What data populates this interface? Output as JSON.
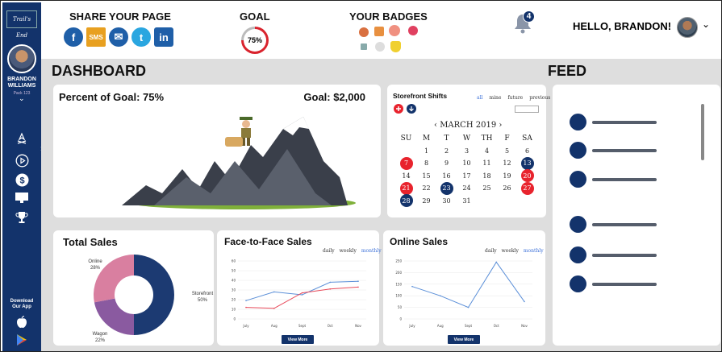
{
  "brand": {
    "logo_text": "Trail's End"
  },
  "sidebar": {
    "user_name_line1": "BRANDON",
    "user_name_line2": "WILLIAMS",
    "pack": "Pack 123",
    "download_line1": "Download",
    "download_line2": "Our App",
    "icons": [
      "campfire-icon",
      "play-icon",
      "dollar-icon",
      "monitor-icon",
      "trophy-icon"
    ]
  },
  "header": {
    "share_title": "SHARE YOUR PAGE",
    "share_buttons": [
      {
        "name": "facebook-icon",
        "glyph": "f",
        "color": "#1f5fa8"
      },
      {
        "name": "sms-icon",
        "glyph": "SMS",
        "color": "#e8a020"
      },
      {
        "name": "email-icon",
        "glyph": "✉",
        "color": "#1f5fa8"
      },
      {
        "name": "twitter-icon",
        "glyph": "t",
        "color": "#2aa6e0"
      },
      {
        "name": "linkedin-icon",
        "glyph": "in",
        "color": "#1f5fa8"
      }
    ],
    "goal_title": "GOAL",
    "goal_pct": "75%",
    "goal_value": 0.75,
    "badges_title": "YOUR BADGES",
    "notification_count": "4",
    "greeting": "HELLO, BRANDON!"
  },
  "dashboard": {
    "title": "DASHBOARD",
    "goal_card": {
      "percent_label": "Percent of Goal: 75%",
      "goal_label": "Goal: $2,000"
    },
    "shifts": {
      "title": "Storefront Shifts",
      "tabs": [
        "all",
        "mine",
        "future",
        "previous"
      ],
      "active_tab": "all",
      "search_placeholder": "",
      "month": "MARCH 2019",
      "prev": "‹",
      "next": "›",
      "days_of_week": [
        "SU",
        "M",
        "T",
        "W",
        "TH",
        "F",
        "SA"
      ],
      "weeks": [
        [
          {
            "d": ""
          },
          {
            "d": "1"
          },
          {
            "d": "2"
          },
          {
            "d": "3"
          },
          {
            "d": "4"
          },
          {
            "d": "5"
          },
          {
            "d": "6"
          }
        ],
        [
          {
            "d": "7",
            "s": "red"
          },
          {
            "d": "8"
          },
          {
            "d": "9"
          },
          {
            "d": "10"
          },
          {
            "d": "11"
          },
          {
            "d": "12"
          },
          {
            "d": "13",
            "s": "blue"
          }
        ],
        [
          {
            "d": "14"
          },
          {
            "d": "15"
          },
          {
            "d": "16"
          },
          {
            "d": "17"
          },
          {
            "d": "18"
          },
          {
            "d": "19"
          },
          {
            "d": "20",
            "s": "red"
          }
        ],
        [
          {
            "d": "21",
            "s": "red"
          },
          {
            "d": "22"
          },
          {
            "d": "23",
            "s": "blue"
          },
          {
            "d": "24"
          },
          {
            "d": "25"
          },
          {
            "d": "26"
          },
          {
            "d": "27",
            "s": "red"
          }
        ],
        [
          {
            "d": "28",
            "s": "blue"
          },
          {
            "d": "29"
          },
          {
            "d": "30"
          },
          {
            "d": "31"
          },
          {
            "d": ""
          },
          {
            "d": ""
          },
          {
            "d": ""
          }
        ]
      ]
    },
    "total_sales": {
      "title": "Total Sales",
      "chart_data": {
        "type": "pie",
        "slices": [
          {
            "label": "Storefront",
            "value": 50,
            "display": "50%",
            "color": "#1c3a72"
          },
          {
            "label": "Wagon",
            "value": 22,
            "display": "22%",
            "color": "#8a5aa0"
          },
          {
            "label": "Online",
            "value": 28,
            "display": "28%",
            "color": "#d97fa0"
          }
        ]
      }
    },
    "f2f_sales": {
      "title": "Face-to-Face Sales",
      "ranges": [
        "daily",
        "weekly",
        "monthly"
      ],
      "active_range": "monthly",
      "view_more": "View More",
      "chart_data": {
        "type": "line",
        "categories": [
          "July",
          "Aug",
          "Sept",
          "Oct",
          "Nov"
        ],
        "ylim": [
          0,
          60
        ],
        "yticks": [
          0,
          10,
          20,
          30,
          40,
          50,
          60
        ],
        "series": [
          {
            "color": "#5b8fd8",
            "values": [
              19,
              28,
              25,
              38,
              39
            ]
          },
          {
            "color": "#e84a5a",
            "values": [
              12,
              11,
              27,
              31,
              33
            ]
          }
        ]
      }
    },
    "online_sales": {
      "title": "Online Sales",
      "ranges": [
        "daily",
        "weekly",
        "monthly"
      ],
      "active_range": "monthly",
      "view_more": "View More",
      "chart_data": {
        "type": "line",
        "categories": [
          "July",
          "Aug",
          "Sept",
          "Oct",
          "Nov"
        ],
        "ylim": [
          0,
          250
        ],
        "yticks": [
          0,
          50,
          100,
          150,
          200,
          250
        ],
        "series": [
          {
            "color": "#5b8fd8",
            "values": [
              140,
              100,
              50,
              245,
              75
            ]
          }
        ]
      }
    }
  },
  "feed": {
    "title": "FEED",
    "item_count": 6
  }
}
